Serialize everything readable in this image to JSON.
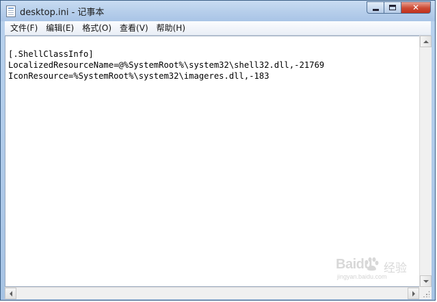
{
  "window": {
    "title": "desktop.ini - 记事本",
    "caption_buttons": {
      "minimize_icon": "minimize-icon",
      "maximize_icon": "maximize-icon",
      "close_label": "✕"
    }
  },
  "menu": {
    "items": [
      {
        "label": "文件(F)",
        "name": "file"
      },
      {
        "label": "编辑(E)",
        "name": "edit"
      },
      {
        "label": "格式(O)",
        "name": "format"
      },
      {
        "label": "查看(V)",
        "name": "view"
      },
      {
        "label": "帮助(H)",
        "name": "help"
      }
    ]
  },
  "editor": {
    "lines": [
      "[.ShellClassInfo]",
      "LocalizedResourceName=@%SystemRoot%\\system32\\shell32.dll,-21769",
      "IconResource=%SystemRoot%\\system32\\imageres.dll,-183"
    ]
  },
  "watermark": {
    "brand": "Baidu",
    "brand_cn": "经验",
    "url": "jingyan.baidu.com"
  },
  "colors": {
    "title_bar": "#b9d2ee",
    "close_button": "#cc4a33",
    "menu_bar": "#f3f6fa",
    "editor_bg": "#ffffff"
  }
}
